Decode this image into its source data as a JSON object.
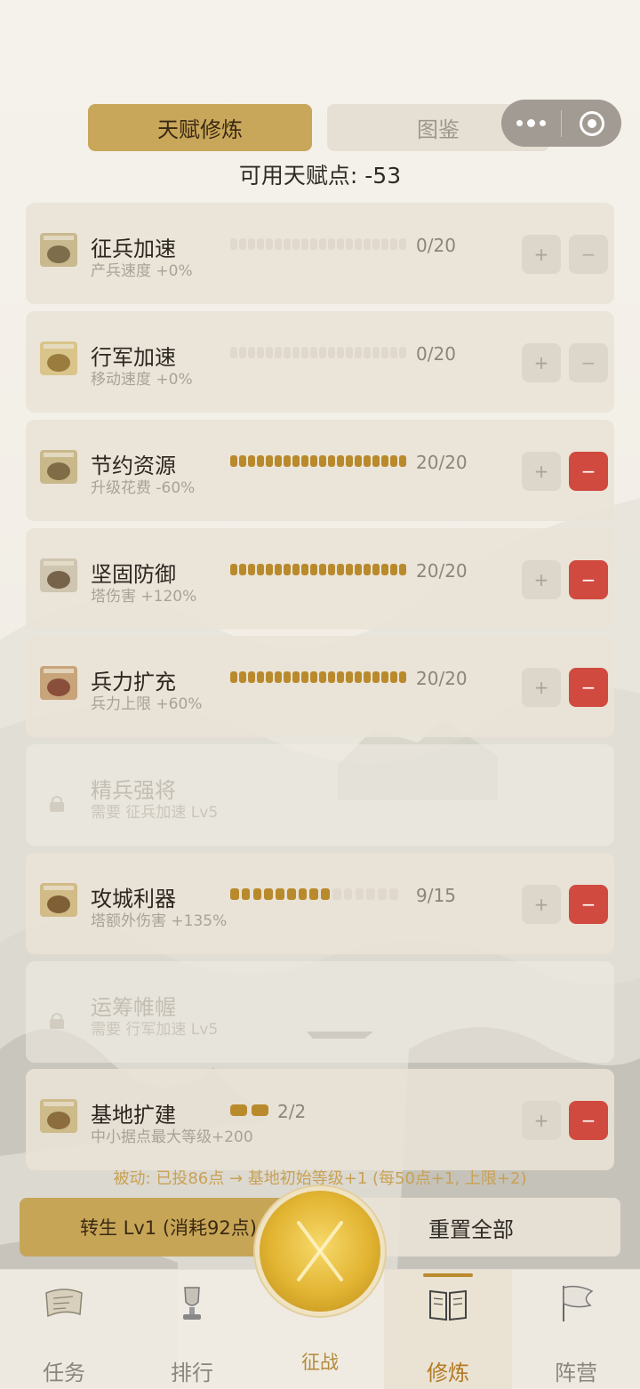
{
  "tabs": {
    "talent": "天赋修炼",
    "codex": "图鉴"
  },
  "points": {
    "label": "可用天赋点:",
    "value": "-53"
  },
  "rows": [
    {
      "name": "征兵加速",
      "desc": "产兵速度 +0%",
      "level": "0/20",
      "current": 0,
      "max": 20,
      "locked": false,
      "minus_active": false
    },
    {
      "name": "行军加速",
      "desc": "移动速度 +0%",
      "level": "0/20",
      "current": 0,
      "max": 20,
      "locked": false,
      "minus_active": false
    },
    {
      "name": "节约资源",
      "desc": "升级花费 -60%",
      "level": "20/20",
      "current": 20,
      "max": 20,
      "locked": false,
      "minus_active": true
    },
    {
      "name": "坚固防御",
      "desc": "塔伤害 +120%",
      "level": "20/20",
      "current": 20,
      "max": 20,
      "locked": false,
      "minus_active": true
    },
    {
      "name": "兵力扩充",
      "desc": "兵力上限 +60%",
      "level": "20/20",
      "current": 20,
      "max": 20,
      "locked": false,
      "minus_active": true
    },
    {
      "name": "精兵强将",
      "desc": "需要 征兵加速 Lv5",
      "locked": true
    },
    {
      "name": "攻城利器",
      "desc": "塔额外伤害 +135%",
      "level": "9/15",
      "current": 9,
      "max": 15,
      "locked": false,
      "minus_active": true
    },
    {
      "name": "运筹帷幄",
      "desc": "需要 行军加速 Lv5",
      "locked": true
    },
    {
      "name": "基地扩建",
      "desc": "中小据点最大等级+200",
      "level": "2/2",
      "current": 2,
      "max": 2,
      "locked": false,
      "minus_active": true
    }
  ],
  "buttons": {
    "plus": "+",
    "minus": "−"
  },
  "passive": "被动: 已投86点 → 基地初始等级+1 (每50点+1, 上限+2)",
  "actions": {
    "rebirth": "转生 Lv1 (消耗92点)",
    "reset": "重置全部"
  },
  "nav": {
    "tasks": "任务",
    "rank": "排行",
    "battle": "征战",
    "train": "修炼",
    "camp": "阵营"
  },
  "colors": {
    "accent": "#c9a75a",
    "progress": "#b98a2c",
    "danger": "#d04a40"
  }
}
